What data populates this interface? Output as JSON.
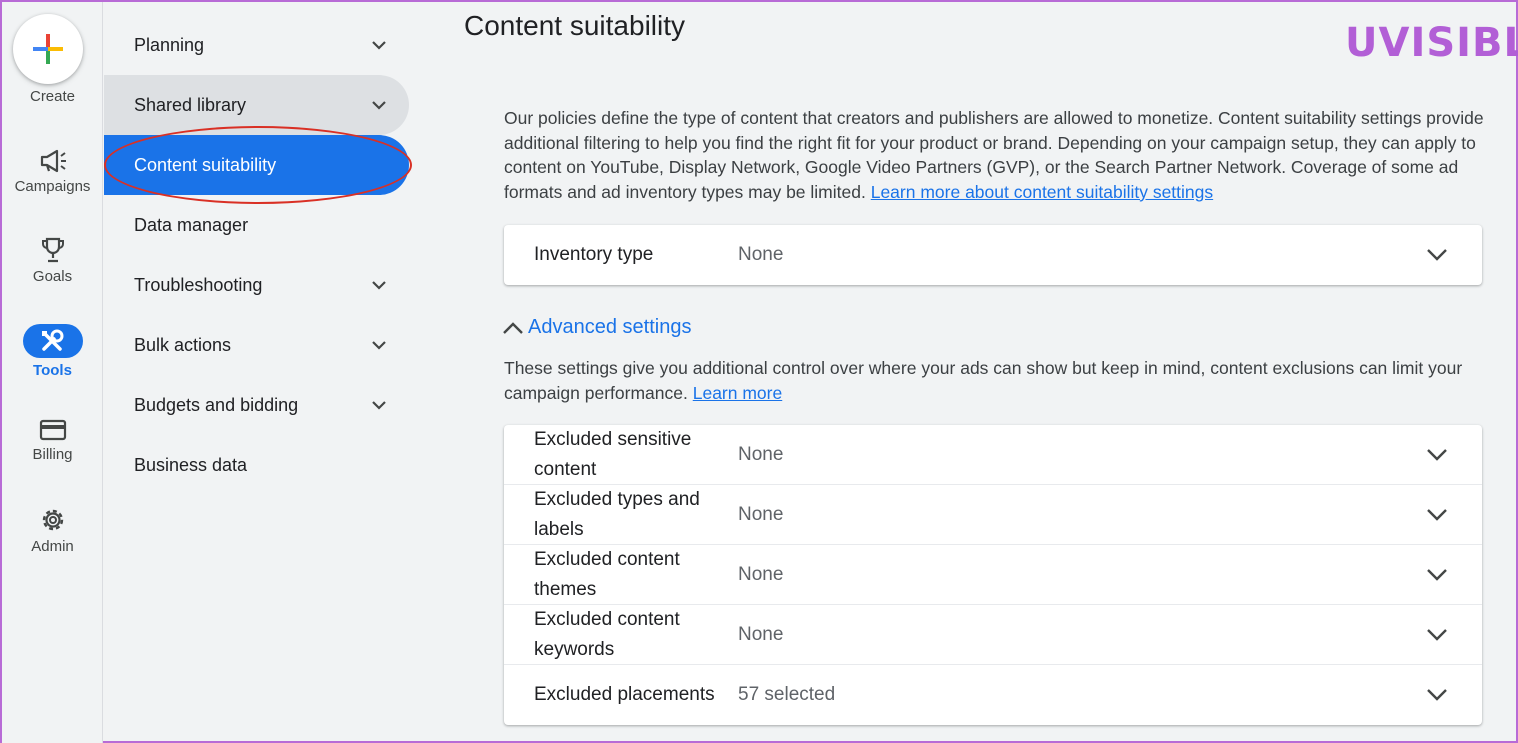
{
  "rail": {
    "create_label": "Create",
    "items": [
      {
        "label": "Campaigns",
        "icon": "megaphone-icon"
      },
      {
        "label": "Goals",
        "icon": "trophy-icon"
      },
      {
        "label": "Tools",
        "icon": "tools-icon"
      },
      {
        "label": "Billing",
        "icon": "credit-card-icon"
      },
      {
        "label": "Admin",
        "icon": "gear-icon"
      }
    ],
    "active": "Tools"
  },
  "subnav": {
    "items": [
      {
        "label": "Planning"
      },
      {
        "label": "Shared library"
      },
      {
        "label": "Content suitability"
      },
      {
        "label": "Data manager"
      },
      {
        "label": "Troubleshooting"
      },
      {
        "label": "Bulk actions"
      },
      {
        "label": "Budgets and bidding"
      },
      {
        "label": "Business data"
      }
    ]
  },
  "page": {
    "title": "Content suitability",
    "logo": "UVISIBLE",
    "intro": "Our policies define the type of content that creators and publishers are allowed to monetize. Content suitability settings provide additional filtering to help you find the right fit for your product or brand. Depending on your campaign setup, they can apply to content on YouTube, Display Network, Google Video Partners (GVP), or the Search Partner Network. Coverage of some ad formats and ad inventory types may be limited.",
    "intro_link": "Learn more about content suitability settings",
    "inventory": {
      "label": "Inventory type",
      "value": "None"
    },
    "advanced_toggle": "Advanced settings",
    "advanced_desc": "These settings give you additional control over where your ads can show but keep in mind, content exclusions can limit your campaign performance.",
    "advanced_link": "Learn more",
    "advanced_rows": [
      {
        "label": "Excluded sensitive content",
        "value": "None"
      },
      {
        "label": "Excluded types and labels",
        "value": "None"
      },
      {
        "label": "Excluded content themes",
        "value": "None"
      },
      {
        "label": "Excluded content keywords",
        "value": "None"
      },
      {
        "label": "Excluded placements",
        "value": "57 selected"
      }
    ]
  },
  "colors": {
    "accent": "#1a73e8",
    "highlight_ring": "#d93025",
    "logo": "#b25fd6"
  }
}
